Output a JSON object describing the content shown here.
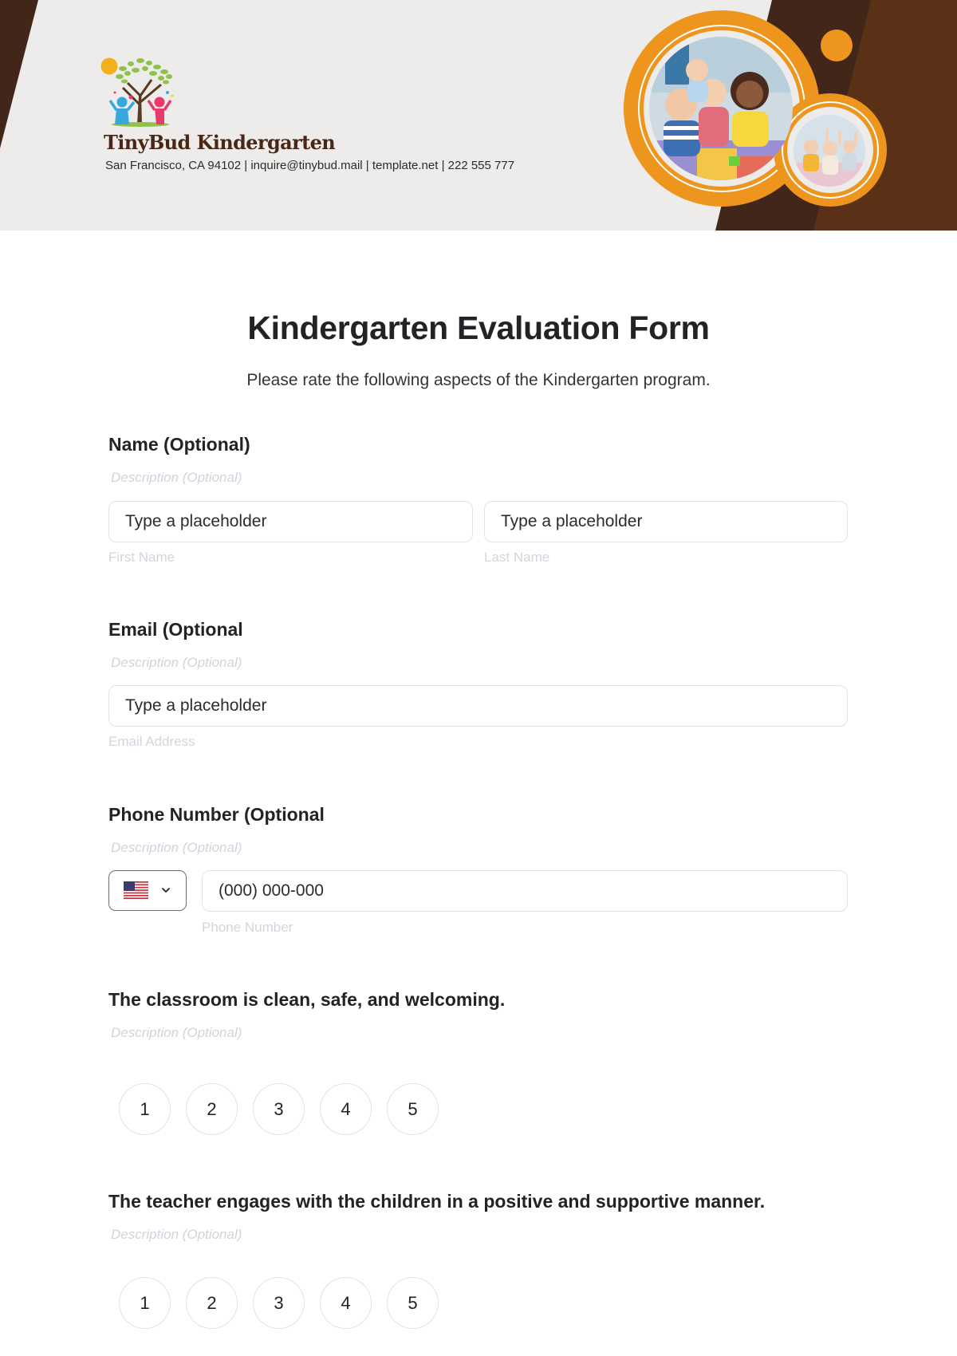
{
  "header": {
    "brand_name": "TinyBud Kindergarten",
    "contact_line": "San Francisco, CA 94102 | inquire@tinybud.mail | template.net | 222 555 777",
    "colors": {
      "dark_brown": "#43261a",
      "brown": "#5a3016",
      "orange": "#ee951e",
      "header_bg": "#edecea"
    }
  },
  "form": {
    "title": "Kindergarten Evaluation Form",
    "subtitle": "Please rate the following aspects of the Kindergarten program.",
    "name": {
      "label": "Name (Optional)",
      "description": "Description (Optional)",
      "first": {
        "placeholder": "Type a placeholder",
        "sublabel": "First Name"
      },
      "last": {
        "placeholder": "Type a placeholder",
        "sublabel": "Last Name"
      }
    },
    "email": {
      "label": "Email (Optional",
      "description": "Description (Optional)",
      "placeholder": "Type a placeholder",
      "sublabel": "Email Address"
    },
    "phone": {
      "label": "Phone Number (Optional",
      "description": "Description (Optional)",
      "country_icon": "us-flag-icon",
      "placeholder": "(000) 000-000",
      "sublabel": "Phone Number"
    },
    "questions": [
      {
        "label": "The classroom is clean, safe, and welcoming.",
        "description": "Description (Optional)",
        "options": [
          "1",
          "2",
          "3",
          "4",
          "5"
        ]
      },
      {
        "label": "The teacher engages with the children in a positive and supportive manner.",
        "description": "Description (Optional)",
        "options": [
          "1",
          "2",
          "3",
          "4",
          "5"
        ]
      }
    ]
  }
}
